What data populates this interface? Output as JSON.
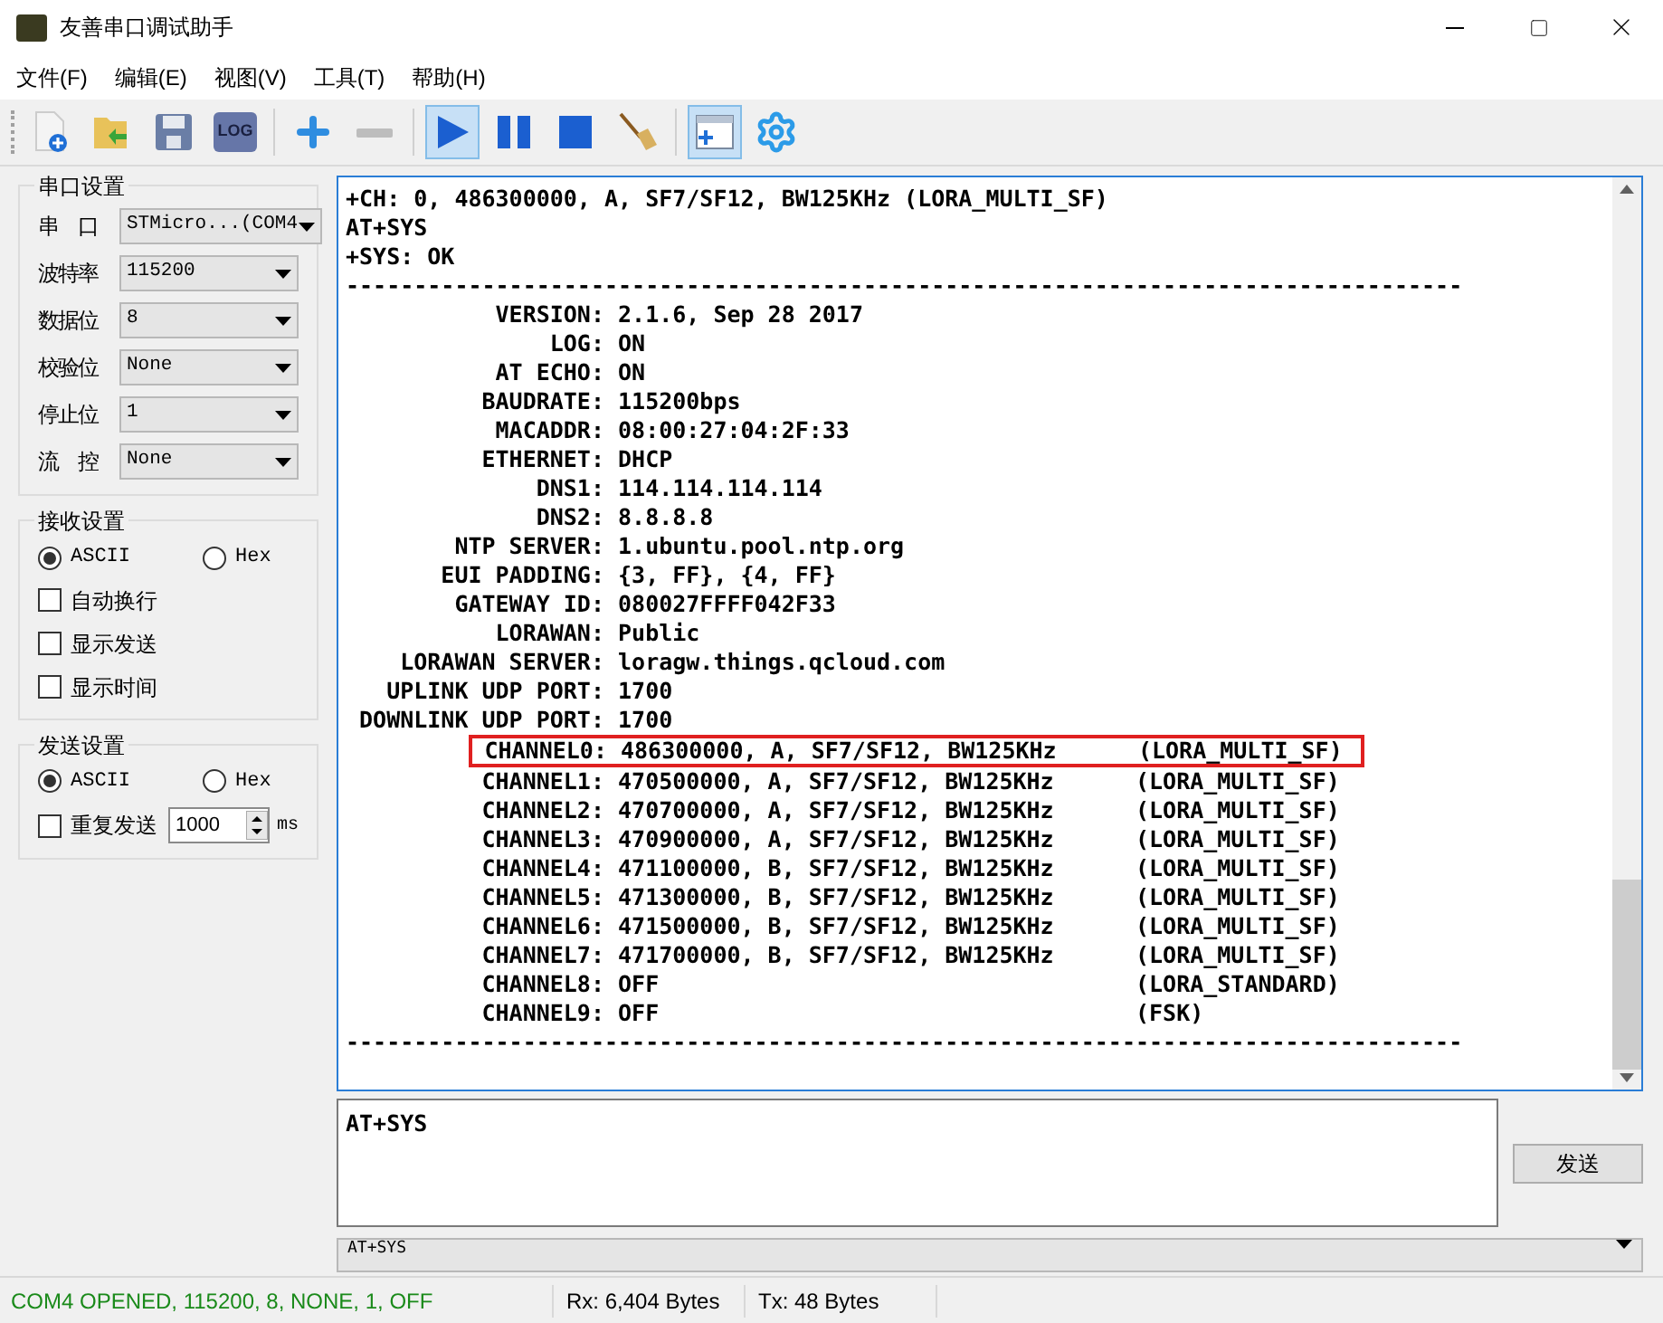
{
  "window": {
    "title": "友善串口调试助手"
  },
  "menu": [
    "文件(F)",
    "编辑(E)",
    "视图(V)",
    "工具(T)",
    "帮助(H)"
  ],
  "toolbar": [
    {
      "kind": "new",
      "selected": false
    },
    {
      "kind": "open",
      "selected": false
    },
    {
      "kind": "save",
      "selected": false
    },
    {
      "kind": "log",
      "label": "LOG",
      "selected": false
    },
    {
      "kind": "sep"
    },
    {
      "kind": "add",
      "selected": false
    },
    {
      "kind": "remove",
      "selected": false
    },
    {
      "kind": "sep"
    },
    {
      "kind": "play",
      "selected": true
    },
    {
      "kind": "pause",
      "selected": false
    },
    {
      "kind": "stop",
      "selected": false
    },
    {
      "kind": "clear",
      "selected": false
    },
    {
      "kind": "sep"
    },
    {
      "kind": "window",
      "selected": true
    },
    {
      "kind": "settings",
      "selected": false
    }
  ],
  "port_settings": {
    "title": "串口设置",
    "fields": [
      {
        "label": "串　口",
        "value": "STMicro...(COM4"
      },
      {
        "label": "波特率",
        "value": "115200"
      },
      {
        "label": "数据位",
        "value": "8"
      },
      {
        "label": "校验位",
        "value": "None"
      },
      {
        "label": "停止位",
        "value": "1"
      },
      {
        "label": "流　控",
        "value": "None"
      }
    ]
  },
  "receive_settings": {
    "title": "接收设置",
    "modes": [
      {
        "label": "ASCII",
        "selected": true
      },
      {
        "label": "Hex",
        "selected": false
      }
    ],
    "options": [
      {
        "label": "自动换行",
        "checked": false
      },
      {
        "label": "显示发送",
        "checked": false
      },
      {
        "label": "显示时间",
        "checked": false
      }
    ]
  },
  "send_settings": {
    "title": "发送设置",
    "modes": [
      {
        "label": "ASCII",
        "selected": true
      },
      {
        "label": "Hex",
        "selected": false
      }
    ],
    "repeat": {
      "label": "重复发送",
      "checked": false
    },
    "interval": "1000",
    "unit": "ms"
  },
  "terminal": {
    "lines": [
      {
        "text": "+CH: 0, 486300000, A, SF7/SF12, BW125KHz (LORA_MULTI_SF)",
        "highlighted": false
      },
      {
        "text": "AT+SYS",
        "highlighted": false
      },
      {
        "text": "+SYS: OK",
        "highlighted": false
      },
      {
        "text": "----------------------------------------------------------------------------------",
        "highlighted": false
      },
      {
        "text": "           VERSION: 2.1.6, Sep 28 2017",
        "highlighted": false
      },
      {
        "text": "               LOG: ON",
        "highlighted": false
      },
      {
        "text": "           AT ECHO: ON",
        "highlighted": false
      },
      {
        "text": "          BAUDRATE: 115200bps",
        "highlighted": false
      },
      {
        "text": "           MACADDR: 08:00:27:04:2F:33",
        "highlighted": false
      },
      {
        "text": "          ETHERNET: DHCP",
        "highlighted": false
      },
      {
        "text": "              DNS1: 114.114.114.114",
        "highlighted": false
      },
      {
        "text": "              DNS2: 8.8.8.8",
        "highlighted": false
      },
      {
        "text": "        NTP SERVER: 1.ubuntu.pool.ntp.org",
        "highlighted": false
      },
      {
        "text": "       EUI PADDING: {3, FF}, {4, FF}",
        "highlighted": false
      },
      {
        "text": "        GATEWAY ID: 080027FFFF042F33",
        "highlighted": false
      },
      {
        "text": "           LORAWAN: Public",
        "highlighted": false
      },
      {
        "text": "    LORAWAN SERVER: loragw.things.qcloud.com",
        "highlighted": false
      },
      {
        "text": "   UPLINK UDP PORT: 1700",
        "highlighted": false
      },
      {
        "text": " DOWNLINK UDP PORT: 1700",
        "highlighted": false
      },
      {
        "text": "          CHANNEL0: 486300000, A, SF7/SF12, BW125KHz      (LORA_MULTI_SF)",
        "highlighted": true
      },
      {
        "text": "          CHANNEL1: 470500000, A, SF7/SF12, BW125KHz      (LORA_MULTI_SF)",
        "highlighted": false
      },
      {
        "text": "          CHANNEL2: 470700000, A, SF7/SF12, BW125KHz      (LORA_MULTI_SF)",
        "highlighted": false
      },
      {
        "text": "          CHANNEL3: 470900000, A, SF7/SF12, BW125KHz      (LORA_MULTI_SF)",
        "highlighted": false
      },
      {
        "text": "          CHANNEL4: 471100000, B, SF7/SF12, BW125KHz      (LORA_MULTI_SF)",
        "highlighted": false
      },
      {
        "text": "          CHANNEL5: 471300000, B, SF7/SF12, BW125KHz      (LORA_MULTI_SF)",
        "highlighted": false
      },
      {
        "text": "          CHANNEL6: 471500000, B, SF7/SF12, BW125KHz      (LORA_MULTI_SF)",
        "highlighted": false
      },
      {
        "text": "          CHANNEL7: 471700000, B, SF7/SF12, BW125KHz      (LORA_MULTI_SF)",
        "highlighted": false
      },
      {
        "text": "          CHANNEL8: OFF                                   (LORA_STANDARD)",
        "highlighted": false
      },
      {
        "text": "          CHANNEL9: OFF                                   (FSK)",
        "highlighted": false
      },
      {
        "text": "----------------------------------------------------------------------------------",
        "highlighted": false
      }
    ]
  },
  "input": {
    "value": "AT+SYS"
  },
  "send_button": "发送",
  "history": {
    "value": "AT+SYS"
  },
  "status_bar": {
    "connection": "COM4 OPENED, 115200, 8, NONE, 1, OFF",
    "rx": "Rx: 6,404 Bytes",
    "tx": "Tx: 48 Bytes"
  }
}
